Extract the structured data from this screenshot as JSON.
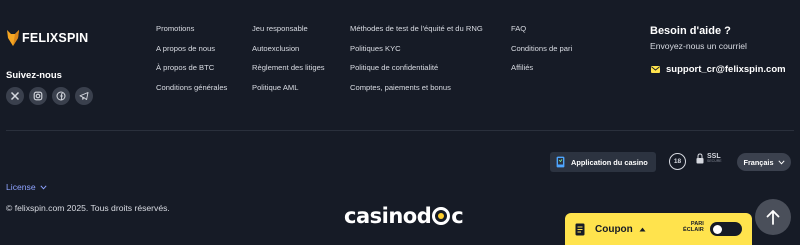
{
  "brand": {
    "name": "FELIXSPIN"
  },
  "social": {
    "title": "Suivez-nous",
    "icons": [
      "x-icon",
      "instagram-icon",
      "facebook-icon",
      "telegram-icon"
    ]
  },
  "links": {
    "col1": [
      "Promotions",
      "A propos de nous",
      "À propos de BTC",
      "Conditions générales"
    ],
    "col2": [
      "Jeu responsable",
      "Autoexclusion",
      "Règlement des litiges",
      "Politique AML"
    ],
    "col3": [
      "Méthodes de test de l'équité et du RNG",
      "Politiques KYC",
      "Politique de confidentialité",
      "Comptes, paiements et bonus"
    ],
    "col4": [
      "FAQ",
      "Conditions de pari",
      "Affiliés"
    ]
  },
  "help": {
    "title": "Besoin d'aide ?",
    "subtitle": "Envoyez-nous un courriel",
    "email": "support_cr@felixspin.com"
  },
  "badges": {
    "app_button": "Application du casino",
    "age": "18",
    "ssl": "SSL",
    "ssl_sub": "SECURE",
    "language": "Français"
  },
  "license": {
    "label": "License"
  },
  "copyright": "© felixspin.com 2025. Tous droits réservés.",
  "partner": {
    "before": "casinod",
    "after": "c"
  },
  "coupon": {
    "label": "Coupon",
    "pari_line1": "PARI",
    "pari_line2": "ÉCLAIR"
  },
  "colors": {
    "background": "#161b26",
    "accent_yellow": "#ffe34d",
    "brand_orange": "#f5a623",
    "link_blue": "#8ea3ff"
  }
}
